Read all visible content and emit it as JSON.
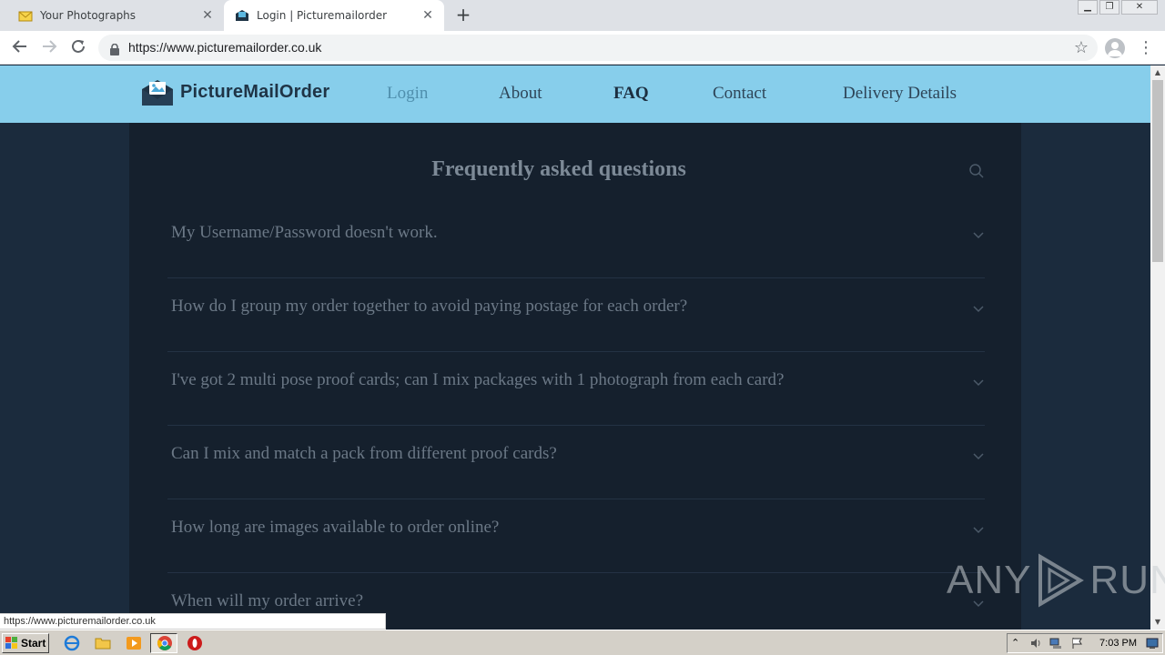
{
  "browser": {
    "tabs": [
      {
        "title": "Your Photographs",
        "icon": "envelope-icon"
      },
      {
        "title": "Login | Picturemailorder",
        "icon": "site-logo-icon"
      }
    ],
    "url": "https://www.picturemailorder.co.uk",
    "status_url": "https://www.picturemailorder.co.uk"
  },
  "site": {
    "logo_text": "PictureMailOrder",
    "nav": [
      {
        "label": "Login",
        "state": "muted"
      },
      {
        "label": "About",
        "state": "normal"
      },
      {
        "label": "FAQ",
        "state": "active"
      },
      {
        "label": "Contact",
        "state": "normal"
      },
      {
        "label": "Delivery Details",
        "state": "normal"
      }
    ],
    "colors": {
      "header_bg": "#87ceeb",
      "page_bg": "#1b2b3d",
      "panel_bg": "#15202d"
    }
  },
  "faq": {
    "title": "Frequently asked questions",
    "items": [
      "My Username/Password doesn't work.",
      "How do I group my order together to avoid paying postage for each order?",
      "I've got 2 multi pose proof cards; can I mix packages with 1 photograph from each card?",
      "Can I mix and match a pack from different proof cards?",
      "How long are images available to order online?",
      "When will my order arrive?"
    ]
  },
  "watermark": {
    "left": "ANY",
    "right": "RUN"
  },
  "taskbar": {
    "start_label": "Start",
    "clock": "7:03 PM"
  }
}
